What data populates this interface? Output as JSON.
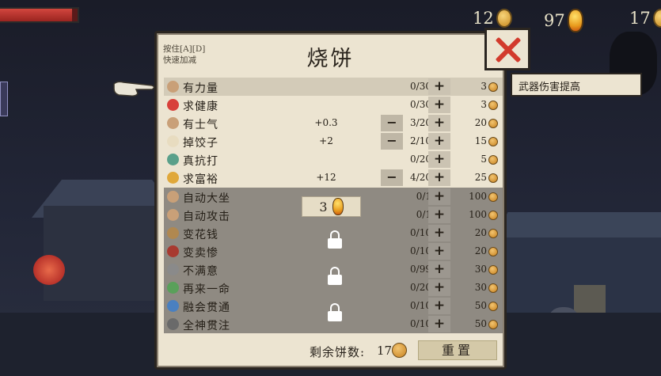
{
  "hud": {
    "hp_fraction": 0.93,
    "coins": "12",
    "gems": "97",
    "cakes": "17"
  },
  "panel": {
    "title": "烧饼",
    "hint_line1": "按住[A][D]",
    "hint_line2": "快速加减"
  },
  "upgrades": [
    {
      "name": "有力量",
      "bonus": "",
      "minus": "",
      "count": "0/30",
      "plus": "+",
      "cost": "3",
      "icon_color": "#c9a078",
      "icon": "fist-icon"
    },
    {
      "name": "求健康",
      "bonus": "",
      "minus": "",
      "count": "0/30",
      "plus": "+",
      "cost": "3",
      "icon_color": "#d8403a",
      "icon": "heart-icon"
    },
    {
      "name": "有士气",
      "bonus": "+0.3",
      "minus": "−",
      "count": "3/20",
      "plus": "+",
      "cost": "20",
      "icon_color": "#c9a078",
      "icon": "hand-icon"
    },
    {
      "name": "掉饺子",
      "bonus": "+2",
      "minus": "−",
      "count": "2/10",
      "plus": "+",
      "cost": "15",
      "icon_color": "#e8dcc0",
      "icon": "dumpling-icon"
    },
    {
      "name": "真抗打",
      "bonus": "",
      "minus": "",
      "count": "0/20",
      "plus": "+",
      "cost": "5",
      "icon_color": "#5aa08a",
      "icon": "armor-icon"
    },
    {
      "name": "求富裕",
      "bonus": "+12",
      "minus": "−",
      "count": "4/20",
      "plus": "+",
      "cost": "25",
      "icon_color": "#e0a83a",
      "icon": "coins-icon"
    },
    {
      "name": "自动大坐",
      "bonus": "",
      "minus": "",
      "count": "0/1",
      "plus": "+",
      "cost": "100",
      "icon_color": "#c9a078",
      "icon": "hand-point-icon"
    },
    {
      "name": "自动攻击",
      "bonus": "",
      "minus": "",
      "count": "0/1",
      "plus": "+",
      "cost": "100",
      "icon_color": "#c9a078",
      "icon": "hand-point-icon"
    },
    {
      "name": "变花钱",
      "bonus": "",
      "minus": "",
      "count": "0/10",
      "plus": "+",
      "cost": "20",
      "icon_color": "#b08850",
      "icon": "coin-spin-icon"
    },
    {
      "name": "变卖惨",
      "bonus": "",
      "minus": "",
      "count": "0/10",
      "plus": "+",
      "cost": "20",
      "icon_color": "#a83a30",
      "icon": "rose-icon"
    },
    {
      "name": "不满意",
      "bonus": "",
      "minus": "",
      "count": "0/99",
      "plus": "+",
      "cost": "30",
      "icon_color": "#8a8a8a",
      "icon": "dice-icon"
    },
    {
      "name": "再来一命",
      "bonus": "",
      "minus": "",
      "count": "0/20",
      "plus": "+",
      "cost": "30",
      "icon_color": "#5aa05a",
      "icon": "mushroom-icon"
    },
    {
      "name": "融会贯通",
      "bonus": "",
      "minus": "",
      "count": "0/10",
      "plus": "+",
      "cost": "50",
      "icon_color": "#4a80c0",
      "icon": "cross-swords-icon"
    },
    {
      "name": "全神贯注",
      "bonus": "",
      "minus": "",
      "count": "0/10",
      "plus": "+",
      "cost": "50",
      "icon_color": "#6a6a6a",
      "icon": "book-icon"
    }
  ],
  "gem_unlock": {
    "cost": "3"
  },
  "footer": {
    "remaining_label": "剩余饼数:",
    "remaining_value": "17",
    "reset_label": "重置"
  },
  "tooltip": {
    "text": "武器伤害提高"
  }
}
